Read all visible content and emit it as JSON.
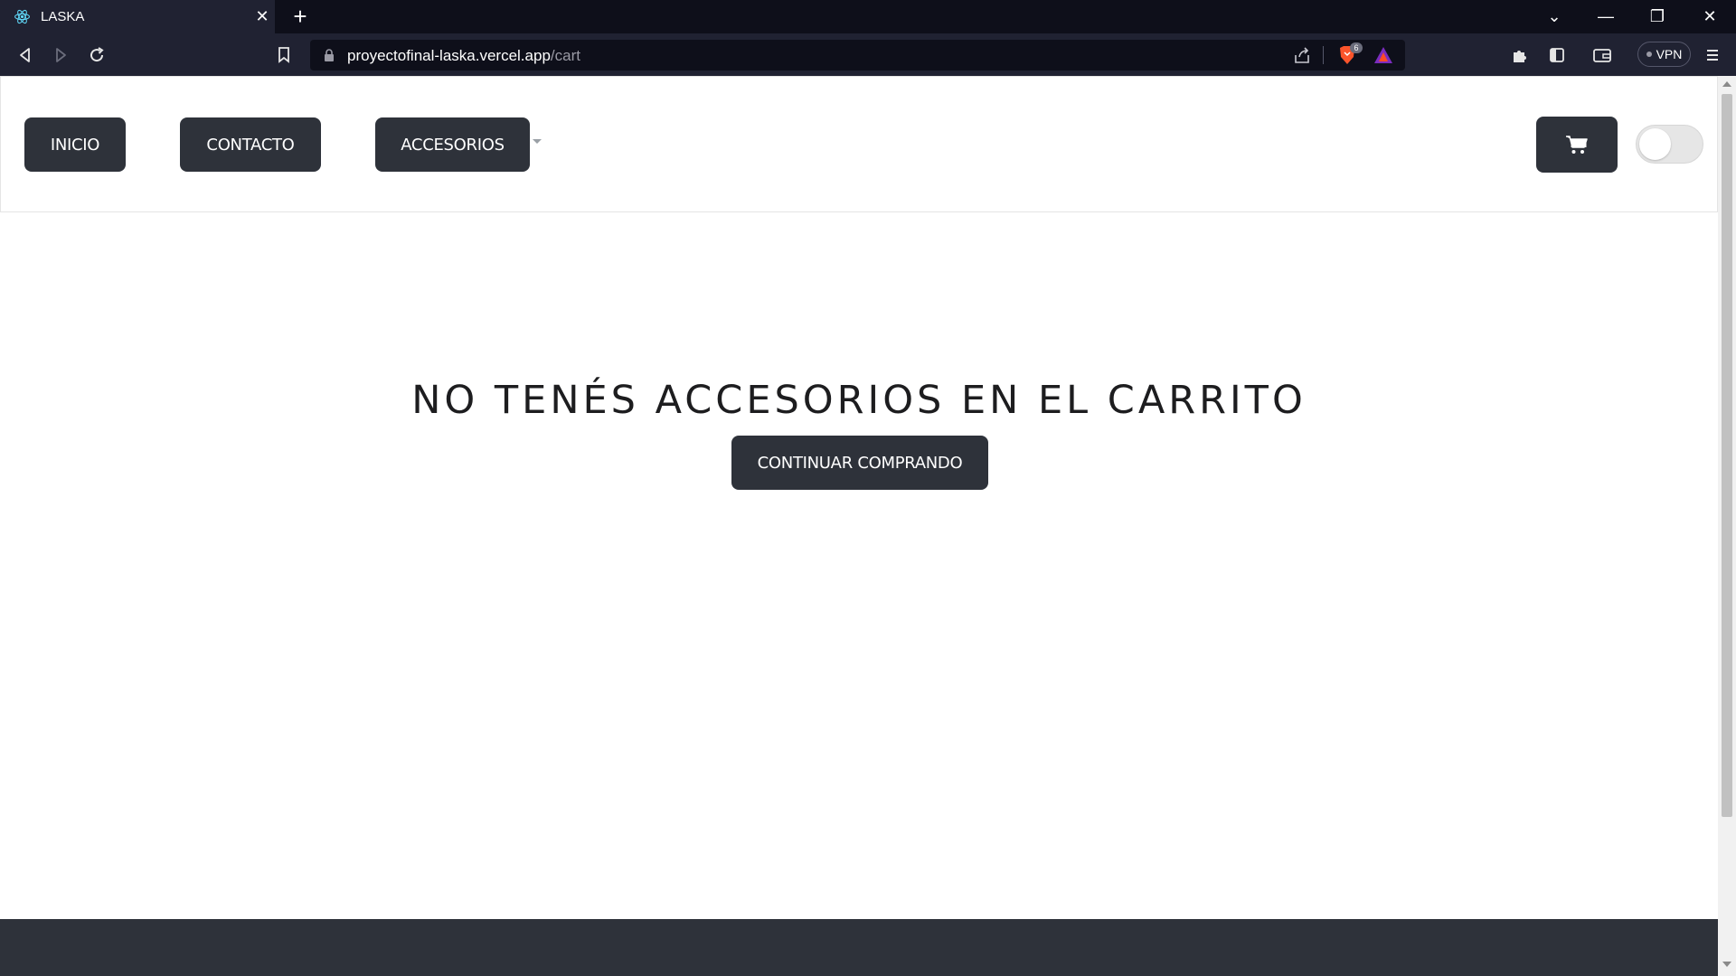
{
  "browser": {
    "tab_title": "LASKA",
    "tab_close": "✕",
    "new_tab": "+",
    "url_host": "proyectofinal-laska.vercel.app",
    "url_path": "/cart",
    "brave_shield_count": "6",
    "vpn_label": "VPN",
    "window_controls": [
      "⌄",
      "—",
      "❐",
      "✕"
    ]
  },
  "nav": {
    "inicio": "INICIO",
    "contacto": "CONTACTO",
    "accesorios": "ACCESORIOS"
  },
  "main": {
    "empty_message": "NO TENÉS ACCESORIOS EN EL CARRITO",
    "continue_label": "CONTINUAR COMPRANDO"
  },
  "colors": {
    "button_bg": "#2e323a",
    "footer_bg": "#2e323a",
    "chrome_dark": "#0e0f1a",
    "chrome_toolbar": "#202232"
  },
  "icons": [
    "react-icon",
    "back-icon",
    "forward-icon",
    "reload-icon",
    "bookmark-icon",
    "lock-icon",
    "share-icon",
    "brave-shield-icon",
    "bat-rewards-icon",
    "extensions-icon",
    "sidebar-icon",
    "wallet-icon",
    "menu-icon",
    "cart-icon"
  ]
}
